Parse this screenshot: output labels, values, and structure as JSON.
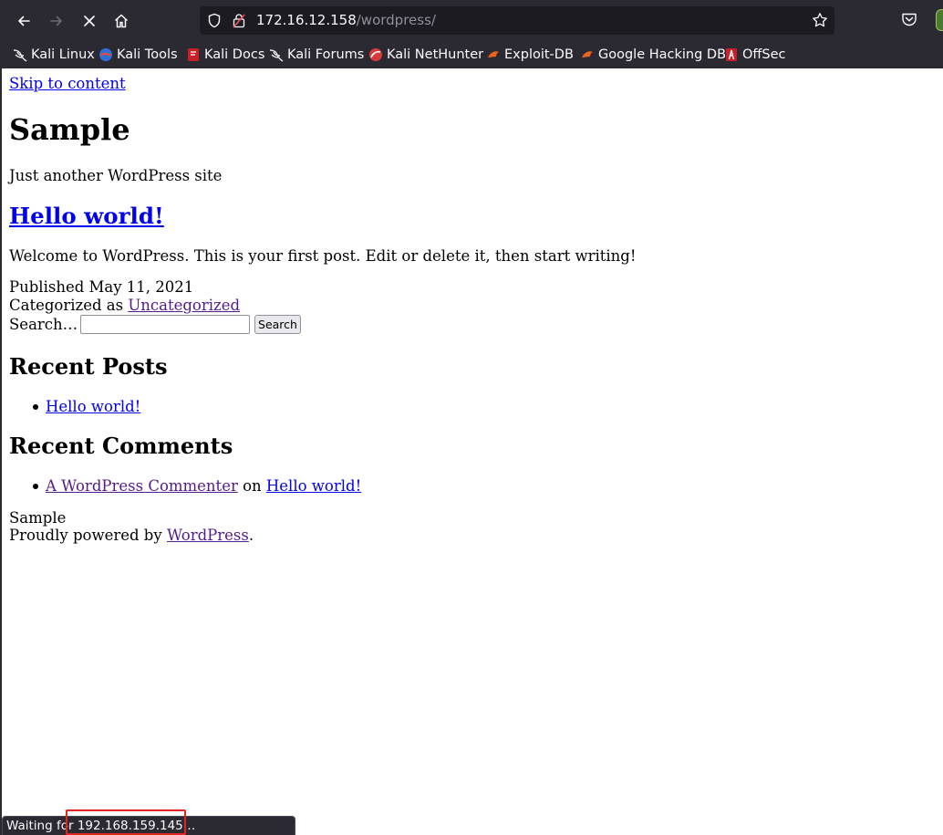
{
  "browser": {
    "url_host": "172.16.12.158",
    "url_path": "/wordpress/",
    "icons": [
      "back-icon",
      "forward-icon",
      "stop-icon",
      "home-icon",
      "shield-icon",
      "insecure-lock-icon",
      "star-icon",
      "pocket-icon"
    ]
  },
  "bookmarks": [
    {
      "label": "Kali Linux",
      "icon": "kali-dragon-icon"
    },
    {
      "label": "Kali Tools",
      "icon": "kali-tools-icon"
    },
    {
      "label": "Kali Docs",
      "icon": "kali-docs-icon"
    },
    {
      "label": "Kali Forums",
      "icon": "kali-dragon-icon"
    },
    {
      "label": "Kali NetHunter",
      "icon": "nethunter-icon"
    },
    {
      "label": "Exploit-DB",
      "icon": "exploit-db-icon"
    },
    {
      "label": "Google Hacking DB",
      "icon": "exploit-db-icon"
    },
    {
      "label": "OffSec",
      "icon": "offsec-icon"
    }
  ],
  "page": {
    "skip_link": "Skip to content",
    "site_title": "Sample",
    "tagline": "Just another WordPress site",
    "post": {
      "title": "Hello world!",
      "body": "Welcome to WordPress. This is your first post. Edit or delete it, then start writing!",
      "published_label": "Published May 11, 2021",
      "categorized_label": "Categorized as",
      "category": "Uncategorized"
    },
    "search": {
      "label": "Search…",
      "value": "",
      "button": "Search"
    },
    "recent_posts": {
      "heading": "Recent Posts",
      "items": [
        "Hello world!"
      ]
    },
    "recent_comments": {
      "heading": "Recent Comments",
      "author": "A WordPress Commenter",
      "on": "on",
      "post": "Hello world!"
    },
    "footer": {
      "site": "Sample",
      "powered_prefix": "Proudly powered by",
      "powered_link": "WordPress",
      "powered_suffix": "."
    }
  },
  "status": {
    "text": "Waiting for 192.168.159.145…",
    "highlight_color": "#e0261e"
  }
}
